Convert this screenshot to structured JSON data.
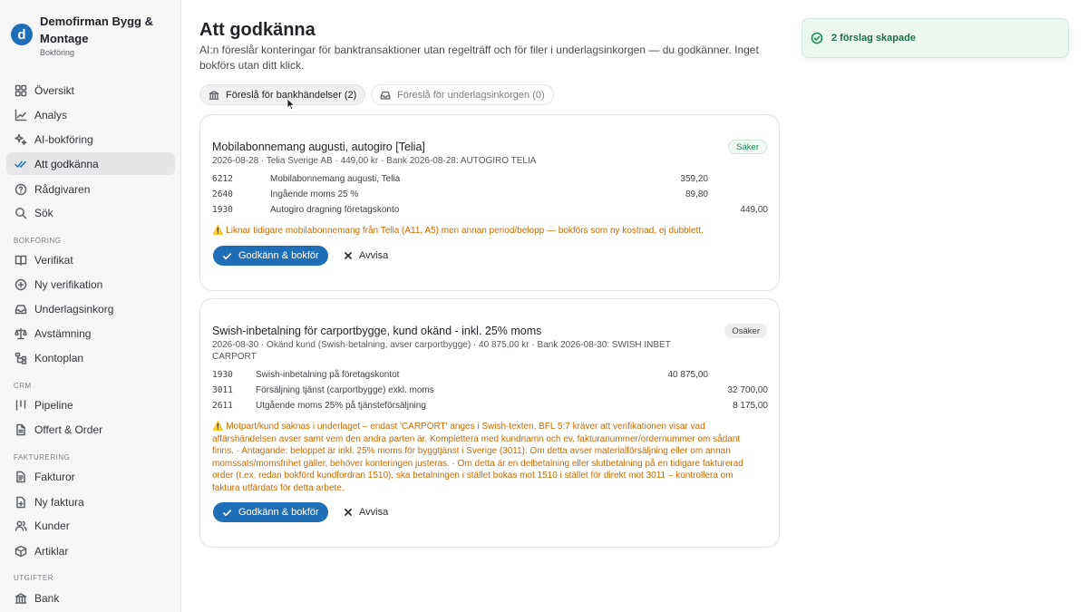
{
  "brand": {
    "logo_letter": "d",
    "name": "Demofirman Bygg & Montage",
    "subtitle": "Bokföring"
  },
  "sidebar": {
    "items": [
      {
        "label": "Översikt",
        "icon": "grid-icon"
      },
      {
        "label": "Analys",
        "icon": "chart-icon"
      },
      {
        "label": "AI-bokföring",
        "icon": "sparkle-icon"
      },
      {
        "label": "Att godkänna",
        "icon": "double-check-icon",
        "active": true
      },
      {
        "label": "Rådgivaren",
        "icon": "chat-help-icon"
      },
      {
        "label": "Sök",
        "icon": "search-icon"
      }
    ],
    "sections": [
      {
        "label": "BOKFÖRING",
        "items": [
          {
            "label": "Verifikat",
            "icon": "book-icon"
          },
          {
            "label": "Ny verifikation",
            "icon": "plus-circle-icon"
          },
          {
            "label": "Underlagsinkorg",
            "icon": "inbox-icon"
          },
          {
            "label": "Avstämning",
            "icon": "scale-icon"
          },
          {
            "label": "Kontoplan",
            "icon": "tree-icon"
          }
        ]
      },
      {
        "label": "CRM",
        "items": [
          {
            "label": "Pipeline",
            "icon": "kanban-icon"
          },
          {
            "label": "Offert & Order",
            "icon": "document-icon"
          }
        ]
      },
      {
        "label": "FAKTURERING",
        "items": [
          {
            "label": "Fakturor",
            "icon": "invoice-icon"
          },
          {
            "label": "Ny faktura",
            "icon": "file-plus-icon"
          },
          {
            "label": "Kunder",
            "icon": "users-icon"
          },
          {
            "label": "Artiklar",
            "icon": "box-icon"
          }
        ]
      },
      {
        "label": "UTGIFTER",
        "items": [
          {
            "label": "Bank",
            "icon": "bank-icon"
          }
        ]
      }
    ]
  },
  "main": {
    "title": "Att godkänna",
    "description": "AI:n föreslår konteringar för banktransaktioner utan regelträff och för filer i underlagsinkorgen — du godkänner. Inget bokförs utan ditt klick.",
    "tabs": [
      {
        "label": "Föreslå för bankhändelser (2)",
        "icon": "bank-icon",
        "active": true
      },
      {
        "label": "Föreslå för underlagsinkorgen (0)",
        "icon": "inbox-icon",
        "active": false
      }
    ],
    "approve_label": "Godkänn & bokför",
    "reject_label": "Avvisa",
    "cards": [
      {
        "title": "Mobilabonnemang augusti, autogiro [Telia]",
        "badge": "Säker",
        "meta": "2026-08-28 · Telia Sverige AB · 449,00 kr · Bank 2026-08-28: AUTOGIRO TELIA",
        "rows": [
          {
            "account": "6212",
            "text": "Mobilabonnemang augusti, Telia",
            "debit": "359,20",
            "credit": ""
          },
          {
            "account": "2640",
            "text": "Ingående moms 25 %",
            "debit": "89,80",
            "credit": ""
          },
          {
            "account": "1930",
            "text": "Autogiro dragning företagskonto",
            "debit": "",
            "credit": "449,00"
          }
        ],
        "warning": "⚠️ Liknar tidigare mobilabonnemang från Telia (A11, A5) men annan period/belopp — bokförs som ny kostnad, ej dubblett."
      },
      {
        "title": "Swish-inbetalning för carportbygge, kund okänd - inkl. 25% moms",
        "badge": "Osäker",
        "meta": "2026-08-30 · Okänd kund (Swish-betalning, avser carportbygge) · 40 875,00 kr · Bank 2026-08-30: SWISH INBET CARPORT",
        "rows": [
          {
            "account": "1930",
            "text": "Swish-inbetalning på företagskontot",
            "debit": "40 875,00",
            "credit": ""
          },
          {
            "account": "3011",
            "text": "Försäljning tjänst (carportbygge) exkl. moms",
            "debit": "",
            "credit": "32 700,00"
          },
          {
            "account": "2611",
            "text": "Utgående moms 25% på tjänsteförsäljning",
            "debit": "",
            "credit": "8 175,00"
          }
        ],
        "warning": "⚠️ Motpart/kund saknas i underlaget – endast 'CARPORT' anges i Swish-texten. BFL 5:7 kräver att verifikationen visar vad affärshändelsen avser samt vem den andra parten är. Komplettera med kundnamn och ev. fakturanummer/ordernummer om sådant finns. · Antagande: beloppet är inkl. 25% moms för byggtjänst i Sverige (3011). Om detta avser materialförsäljning eller om annan momssats/momsfrihet gäller, behöver konteringen justeras. · Om detta är en delbetalning eller slutbetalning på en tidigare fakturerad order (t.ex. redan bokförd kundfordran 1510), ska betalningen i stället bokas mot 1510 i stället för direkt mot 3011 – kontrollera om faktura utfärdats för detta arbete."
      }
    ]
  },
  "toast": {
    "message": "2 förslag skapade",
    "icon": "check-circle-icon"
  },
  "colors": {
    "accent": "#1f6fb8",
    "warning": "#c96a00",
    "success": "#1b8a52"
  }
}
